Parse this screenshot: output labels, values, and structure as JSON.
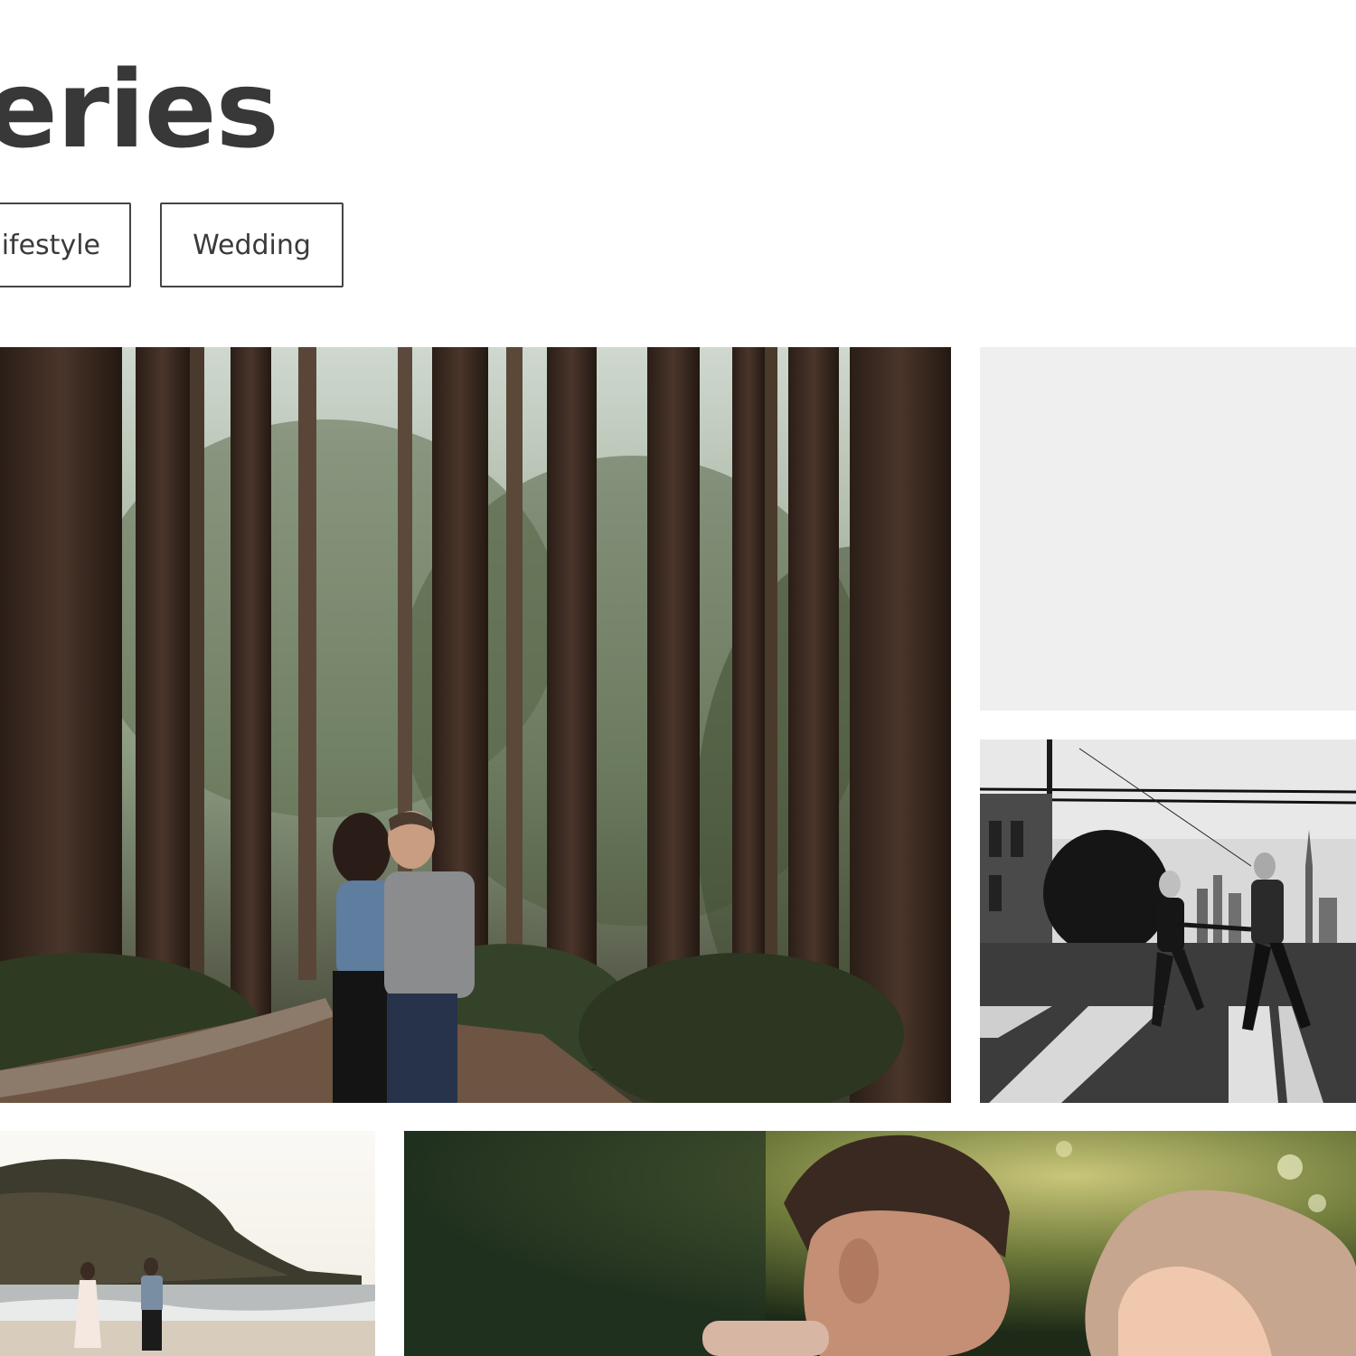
{
  "header": {
    "title": "lleries"
  },
  "filters": [
    {
      "label": "ifestyle"
    },
    {
      "label": "Wedding"
    }
  ],
  "gallery": {
    "tiles": [
      {
        "name": "forest-couple-photo",
        "loaded": true
      },
      {
        "name": "image-placeholder",
        "loaded": false
      },
      {
        "name": "street-crosswalk-photo",
        "loaded": true
      },
      {
        "name": "beach-couple-photo",
        "loaded": true
      },
      {
        "name": "couple-portrait-photo",
        "loaded": true
      }
    ]
  },
  "colors": {
    "text": "#383838",
    "button_border": "#444444",
    "placeholder_bg": "#efefef",
    "page_bg": "#ffffff"
  }
}
